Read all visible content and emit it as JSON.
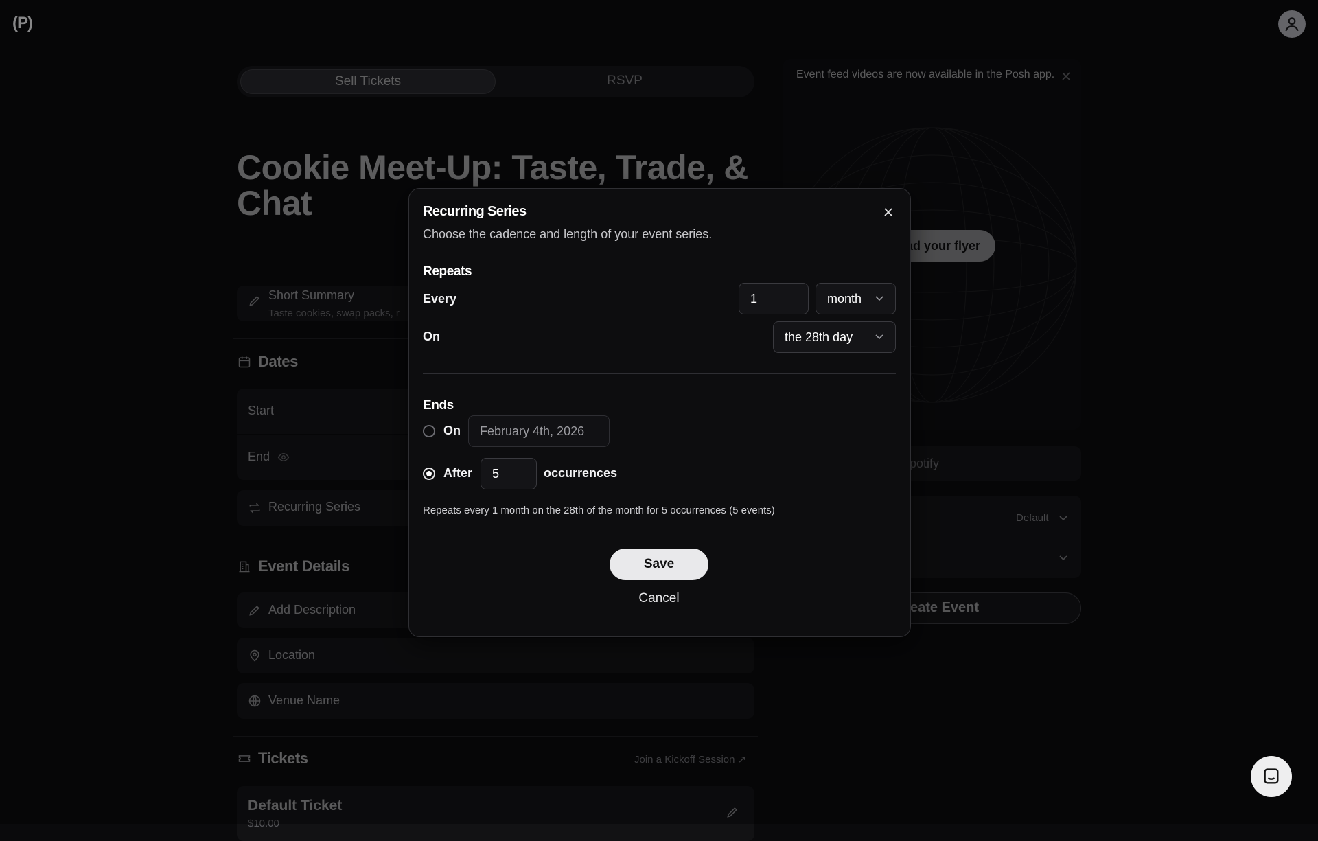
{
  "app": {
    "logo_text": "(P)"
  },
  "mode_toggle": {
    "sell_label": "Sell Tickets",
    "rsvp_label": "RSVP"
  },
  "event": {
    "title": "Cookie Meet-Up: Taste, Trade, & Chat"
  },
  "summary": {
    "label": "Short Summary",
    "preview": "Taste cookies, swap packs, r"
  },
  "dates": {
    "heading": "Dates",
    "start_label": "Start",
    "end_label": "End",
    "recurring_label": "Recurring Series"
  },
  "details": {
    "heading": "Event Details",
    "description_label": "Add Description",
    "location_label": "Location",
    "venue_label": "Venue Name"
  },
  "tickets": {
    "heading": "Tickets",
    "kickoff_link": "Join a Kickoff Session",
    "default_ticket_name": "Default Ticket",
    "default_ticket_price": "$10.00"
  },
  "right": {
    "banner_text": "Event feed videos are now available in the Posh app.",
    "flyer_button": "ad your flyer",
    "spotify_placeholder": "potify",
    "theme_value": "Default",
    "create_button": "eate Event"
  },
  "modal": {
    "title": "Recurring Series",
    "description": "Choose the cadence and length of your event series.",
    "repeats_heading": "Repeats",
    "every_label": "Every",
    "every_value": "1",
    "every_unit": "month",
    "on_label": "On",
    "on_value": "the 28th day",
    "ends_heading": "Ends",
    "ends_on_label": "On",
    "ends_on_date": "February 4th, 2026",
    "ends_after_label": "After",
    "ends_after_value": "5",
    "occurrences_label": "occurrences",
    "summary_text": "Repeats every 1 month on the 28th of the month for 5 occurrences (5 events)",
    "save_label": "Save",
    "cancel_label": "Cancel",
    "selected_end_option": "after"
  }
}
